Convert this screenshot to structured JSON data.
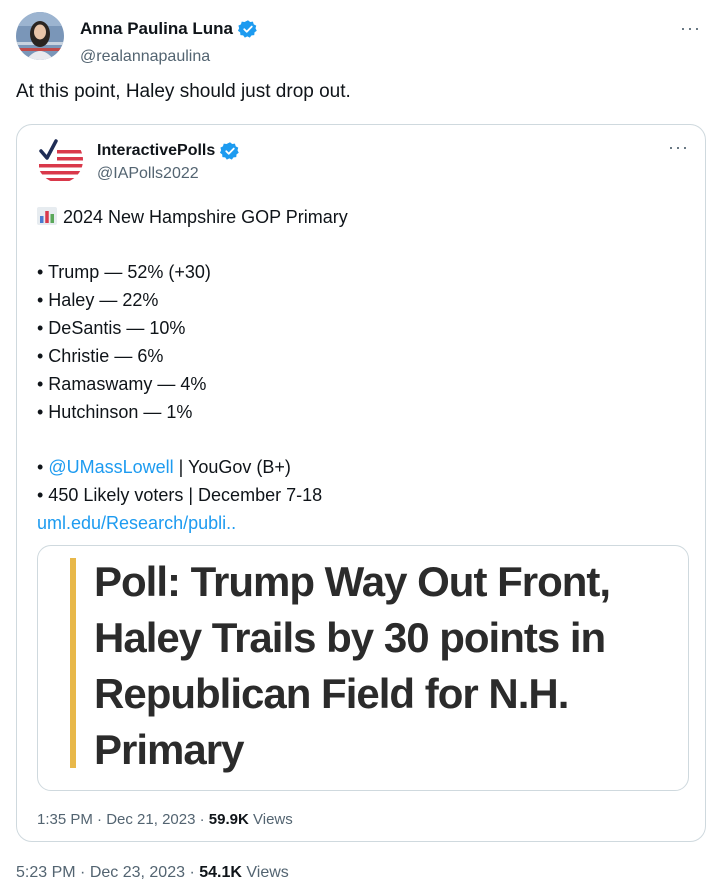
{
  "author": {
    "name": "Anna Paulina Luna",
    "handle": "@realannapaulina"
  },
  "tweet": {
    "text": "At this point, Haley should just drop out.",
    "time": "5:23 PM",
    "date": "Dec 23, 2023",
    "views_count": "54.1K",
    "views_label": "Views"
  },
  "quoted": {
    "name": "InteractivePolls",
    "handle": "@IAPolls2022",
    "title": "2024 New Hampshire GOP Primary",
    "results": [
      "• Trump — 52% (+30)",
      "• Haley — 22%",
      "• DeSantis — 10%",
      "• Christie — 6%",
      "• Ramaswamy — 4%",
      "• Hutchinson — 1%"
    ],
    "source_bullet": "• ",
    "source_mention": "@UMassLowell",
    "source_rest": " | YouGov (B+)",
    "sample": "• 450 Likely voters | December 7-18",
    "link": "uml.edu/Research/publi..",
    "card_headline": "Poll: Trump Way Out Front, Haley Trails by 30 points in Republican Field for N.H. Primary",
    "time": "1:35 PM",
    "date": "Dec 21, 2023",
    "views_count": "59.9K",
    "views_label": "Views"
  },
  "separators": {
    "dot": " · ",
    "more": "···"
  },
  "colors": {
    "link": "#1d9bf0",
    "verified": "#1d9bf0",
    "muted": "#536471",
    "card_accent": "#e8b84a"
  }
}
